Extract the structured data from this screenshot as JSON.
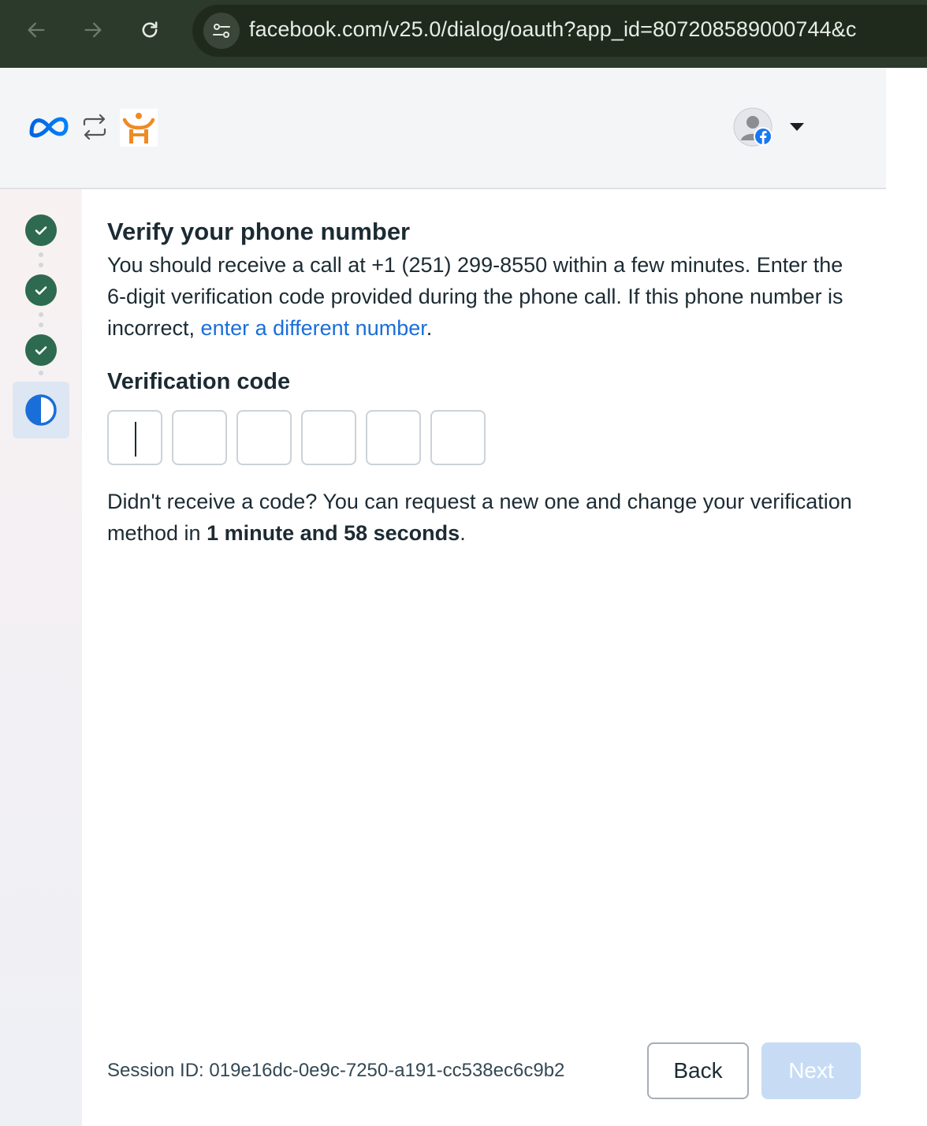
{
  "browser": {
    "url": "facebook.com/v25.0/dialog/oauth?app_id=807208589000744&c",
    "icons": [
      "back-arrow-icon",
      "forward-arrow-icon",
      "reload-icon",
      "site-settings-icon"
    ]
  },
  "header": {
    "icons": [
      "meta-logo-icon",
      "swap-arrows-icon",
      "app-logo-icon",
      "account-avatar-icon",
      "caret-down-icon"
    ]
  },
  "steps": [
    {
      "status": "complete"
    },
    {
      "status": "complete"
    },
    {
      "status": "complete"
    },
    {
      "status": "current"
    }
  ],
  "main": {
    "title": "Verify your phone number",
    "description_prefix": "You should receive a call at +1 (251) 299-8550 within a few minutes. Enter the 6-digit verification code provided during the phone call. If this phone number is incorrect, ",
    "description_link": "enter a different number",
    "description_suffix": ".",
    "code_label": "Verification code",
    "code_digits": [
      "",
      "",
      "",
      "",
      "",
      ""
    ],
    "resend_prefix": "Didn't receive a code? You can request a new one and change your verification method in ",
    "resend_time": "1 minute and 58 seconds",
    "resend_suffix": "."
  },
  "footer": {
    "session_id": "Session ID: 019e16dc-0e9c-7250-a191-cc538ec6c9b2",
    "back_label": "Back",
    "next_label": "Next"
  },
  "colors": {
    "browser_bar": "#2b3a2a",
    "step_complete": "#2d6a4f",
    "step_current": "#1a6ed8",
    "link": "#1a6ed8",
    "next_disabled": "#c7dcf4"
  }
}
